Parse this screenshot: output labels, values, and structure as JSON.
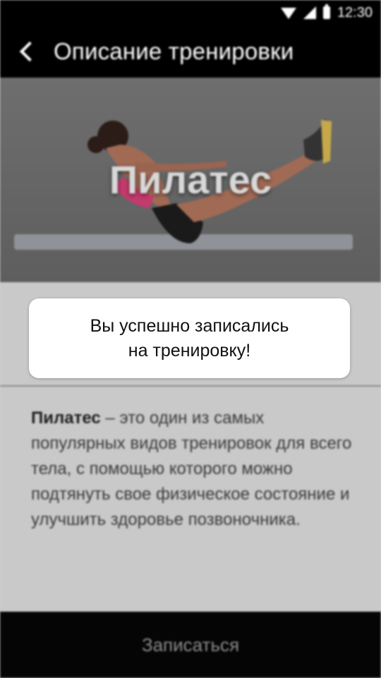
{
  "status_bar": {
    "time": "12:30",
    "icons": [
      "wifi-icon",
      "cellular-icon",
      "battery-icon"
    ]
  },
  "header": {
    "title": "Описание тренировки",
    "back_icon": "chevron-left-icon"
  },
  "hero": {
    "title": "Пилатес"
  },
  "description": {
    "bold": "Пилатес",
    "text": " – это один из самых популярных видов тренировок для всего тела, с помощью которого можно подтянуть свое физическое состояние и улучшить здоровье позвоночника."
  },
  "toast": {
    "line1": "Вы успешно записались",
    "line2": "на тренировку!"
  },
  "footer": {
    "button_label": "Записаться"
  },
  "colors": {
    "bar": "#000000",
    "overlay_bg": "#c9c9c9",
    "toast_bg": "#ffffff"
  }
}
